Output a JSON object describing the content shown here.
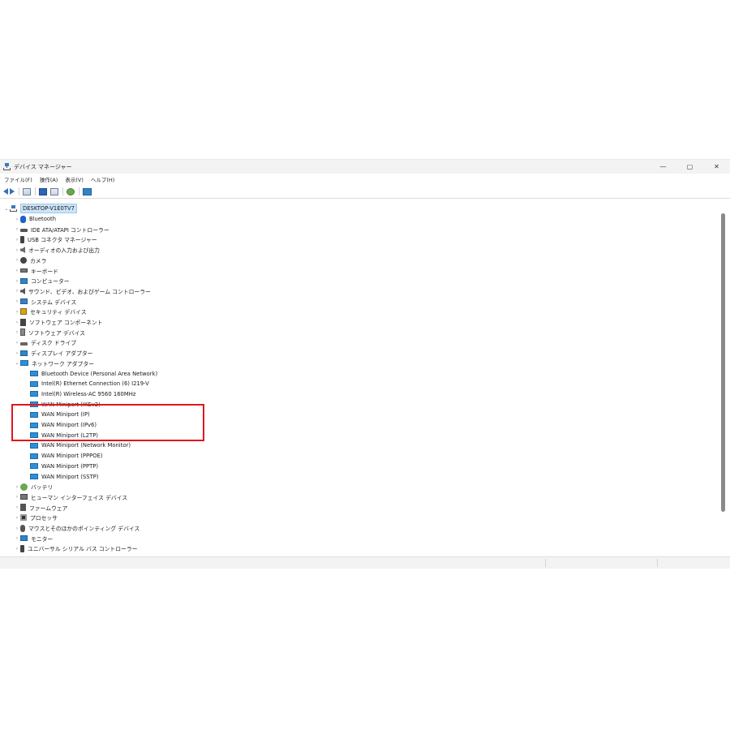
{
  "window": {
    "title": "デバイス マネージャー",
    "controls": {
      "minimize": "—",
      "restore": "▢",
      "close": "✕"
    }
  },
  "menu": [
    "ファイル(F)",
    "操作(A)",
    "表示(V)",
    "ヘルプ(H)"
  ],
  "toolbar": {
    "icons": [
      "back-arrow-icon",
      "forward-arrow-icon",
      "properties-grid-icon",
      "help-icon",
      "view-grid-icon",
      "scan-hardware-icon",
      "monitor-icon"
    ]
  },
  "tree": {
    "root": "DESKTOP-V1E0TV7",
    "categories": [
      {
        "label": "Bluetooth",
        "icon": "bluetooth-icon"
      },
      {
        "label": "IDE ATA/ATAPI コントローラー",
        "icon": "ide-controller-icon"
      },
      {
        "label": "USB コネクタ マネージャー",
        "icon": "usb-icon"
      },
      {
        "label": "オーディオの入力および出力",
        "icon": "audio-icon"
      },
      {
        "label": "カメラ",
        "icon": "camera-icon"
      },
      {
        "label": "キーボード",
        "icon": "keyboard-icon"
      },
      {
        "label": "コンピューター",
        "icon": "computer-icon"
      },
      {
        "label": "サウンド、ビデオ、およびゲーム コントローラー",
        "icon": "sound-icon"
      },
      {
        "label": "システム デバイス",
        "icon": "system-devices-icon"
      },
      {
        "label": "セキュリティ デバイス",
        "icon": "security-icon"
      },
      {
        "label": "ソフトウェア コンポーネント",
        "icon": "software-component-icon"
      },
      {
        "label": "ソフトウェア デバイス",
        "icon": "software-device-icon"
      },
      {
        "label": "ディスク ドライブ",
        "icon": "disk-drive-icon"
      },
      {
        "label": "ディスプレイ アダプター",
        "icon": "display-adapter-icon"
      }
    ],
    "network": {
      "label": "ネットワーク アダプター",
      "children": [
        "Bluetooth Device (Personal Area Network)",
        "Intel(R) Ethernet Connection (6) I219-V",
        "Intel(R) Wireless-AC 9560 160MHz",
        "WAN Miniport (IKEv2)",
        "WAN Miniport (IP)",
        "WAN Miniport (IPv6)",
        "WAN Miniport (L2TP)",
        "WAN Miniport (Network Monitor)",
        "WAN Miniport (PPPOE)",
        "WAN Miniport (PPTP)",
        "WAN Miniport (SSTP)"
      ]
    },
    "after": [
      {
        "label": "バッテリ",
        "icon": "battery-icon"
      },
      {
        "label": "ヒューマン インターフェイス デバイス",
        "icon": "hid-icon"
      },
      {
        "label": "ファームウェア",
        "icon": "firmware-icon"
      },
      {
        "label": "プロセッサ",
        "icon": "processor-icon"
      },
      {
        "label": "マウスとそのほかのポインティング デバイス",
        "icon": "mouse-icon"
      },
      {
        "label": "モニター",
        "icon": "monitor-icon"
      },
      {
        "label": "ユニバーサル シリアル バス コントローラー",
        "icon": "serial-bus-icon"
      }
    ]
  },
  "colors": {
    "highlight_box": "#e0161d",
    "selection": "#cce4f7"
  }
}
